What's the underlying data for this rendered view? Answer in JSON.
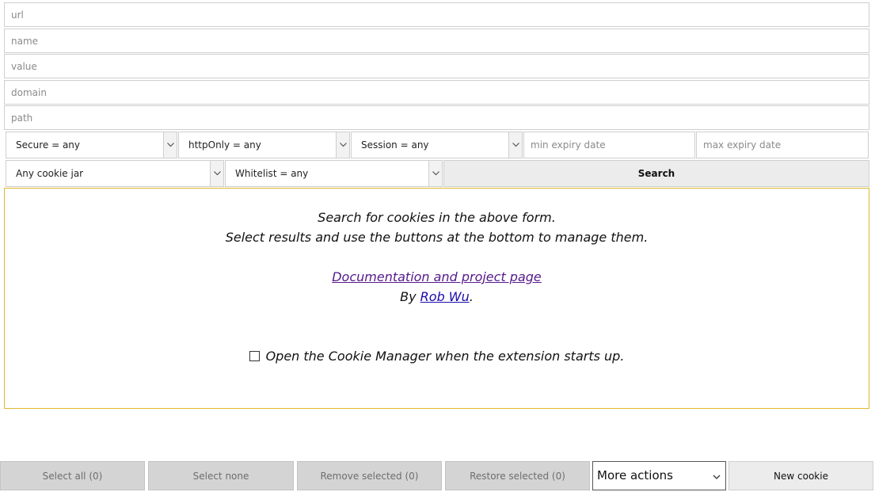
{
  "filters": {
    "url_placeholder": "url",
    "name_placeholder": "name",
    "value_placeholder": "value",
    "domain_placeholder": "domain",
    "path_placeholder": "path",
    "secure": "Secure = any",
    "httponly": "httpOnly = any",
    "session": "Session = any",
    "min_expiry_placeholder": "min expiry date",
    "max_expiry_placeholder": "max expiry date",
    "cookie_jar": "Any cookie jar",
    "whitelist": "Whitelist = any",
    "search_label": "Search"
  },
  "info": {
    "line1": "Search for cookies in the above form.",
    "line2": "Select results and use the buttons at the bottom to manage them.",
    "doc_link": "Documentation and project page",
    "by_prefix": "By ",
    "author": "Rob Wu",
    "by_suffix": ".",
    "startup_option": "Open the Cookie Manager when the extension starts up."
  },
  "footer": {
    "select_all": "Select all (0)",
    "select_none": "Select none",
    "remove_selected": "Remove selected (0)",
    "restore_selected": "Restore selected (0)",
    "more_actions": "More actions",
    "new_cookie": "New cookie"
  },
  "colors": {
    "panel_border": "#e0b62f",
    "visited_link": "#551a8b",
    "link": "#1a0dab"
  }
}
